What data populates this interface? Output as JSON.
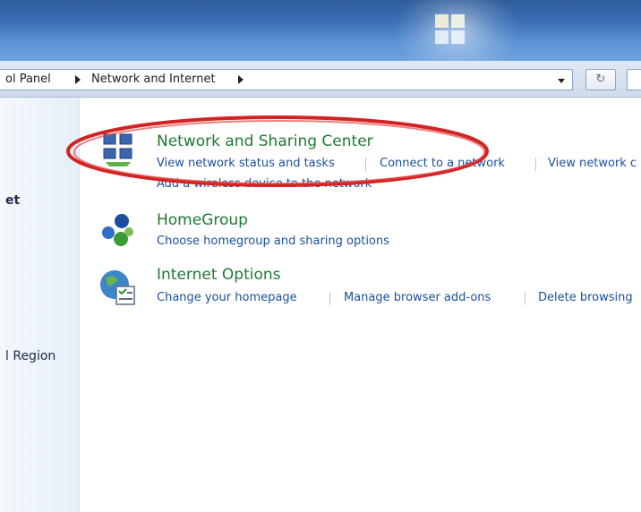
{
  "address_bar": {
    "crumbs": [
      "ol Panel",
      "Network and Internet"
    ],
    "refresh_glyph": "↻",
    "icons": [
      "dropdown-icon",
      "refresh-icon"
    ]
  },
  "left_pane": {
    "items": [
      "et",
      "l Region"
    ]
  },
  "categories": [
    {
      "title": "Network and Sharing Center",
      "icon": "network-sharing-icon",
      "links": [
        "View network status and tasks",
        "Connect to a network",
        "View network c",
        "Add a wireless device to the network"
      ]
    },
    {
      "title": "HomeGroup",
      "icon": "homegroup-icon",
      "links": [
        "Choose homegroup and sharing options"
      ]
    },
    {
      "title": "Internet Options",
      "icon": "internet-options-icon",
      "links": [
        "Change your homepage",
        "Manage browser add-ons",
        "Delete browsing"
      ]
    }
  ],
  "highlight": {
    "color": "#d42222"
  }
}
